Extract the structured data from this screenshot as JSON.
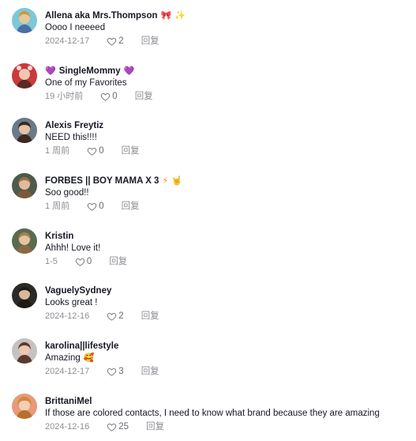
{
  "comments": [
    {
      "username": "Allena aka Mrs.Thompson",
      "username_emojis": [
        "🎀",
        "✨"
      ],
      "text": "Oooo I neeeed",
      "text_emoji": "",
      "date": "2024-12-17",
      "likes": "2",
      "reply_label": "回复",
      "avatar_colors": [
        "#7dc7d8",
        "#e8c79a",
        "#4a6fa5"
      ]
    },
    {
      "username": "SingleMommy",
      "username_prefix_emoji": "💜",
      "username_emojis": [
        "💜"
      ],
      "text": "One of my Favorites",
      "text_emoji": "",
      "date": "19 小时前",
      "likes": "0",
      "reply_label": "回复",
      "avatar_colors": [
        "#c93a3a",
        "#f2c7b0",
        "#5a2a22"
      ]
    },
    {
      "username": "Alexis Freytiz",
      "username_emojis": [],
      "text": "NEED this!!!!",
      "text_emoji": "",
      "date": "1 周前",
      "likes": "0",
      "reply_label": "回复",
      "avatar_colors": [
        "#6b7a88",
        "#e5c3a5",
        "#3b2a20"
      ]
    },
    {
      "username": "FORBES || BOY MAMA X 3",
      "username_emojis": [
        "⚡",
        "🤘"
      ],
      "text": "Soo good!!",
      "text_emoji": "",
      "date": "1 周前",
      "likes": "0",
      "reply_label": "回复",
      "avatar_colors": [
        "#4e5a4a",
        "#e2b99c",
        "#7a5a3a"
      ]
    },
    {
      "username": "Kristin",
      "username_emojis": [],
      "text": "Ahhh! Love it!",
      "text_emoji": "",
      "date": "1-5",
      "likes": "0",
      "reply_label": "回复",
      "avatar_colors": [
        "#5b6b4e",
        "#e6c2a2",
        "#8a6a44"
      ]
    },
    {
      "username": "VaguelySydney",
      "username_emojis": [],
      "text": "Looks great !",
      "text_emoji": "",
      "date": "2024-12-16",
      "likes": "2",
      "reply_label": "回复",
      "avatar_colors": [
        "#2b2a26",
        "#d9b89a",
        "#1e1a16"
      ]
    },
    {
      "username": "karolina||lifestyle",
      "username_emojis": [],
      "text": "Amazing",
      "text_emoji": "🥰",
      "date": "2024-12-17",
      "likes": "3",
      "reply_label": "回复",
      "avatar_colors": [
        "#c7c2c0",
        "#ecc7ad",
        "#5a3a2c"
      ]
    },
    {
      "username": "BrittaniMel",
      "username_emojis": [],
      "text": "If those are colored contacts, I need to know what brand because they are amazing",
      "text_emoji": "",
      "date": "2024-12-16",
      "likes": "25",
      "reply_label": "回复",
      "avatar_colors": [
        "#e89a7a",
        "#f3cfb3",
        "#b5702d"
      ]
    }
  ],
  "icons": {
    "like": "heart-outline-icon"
  }
}
